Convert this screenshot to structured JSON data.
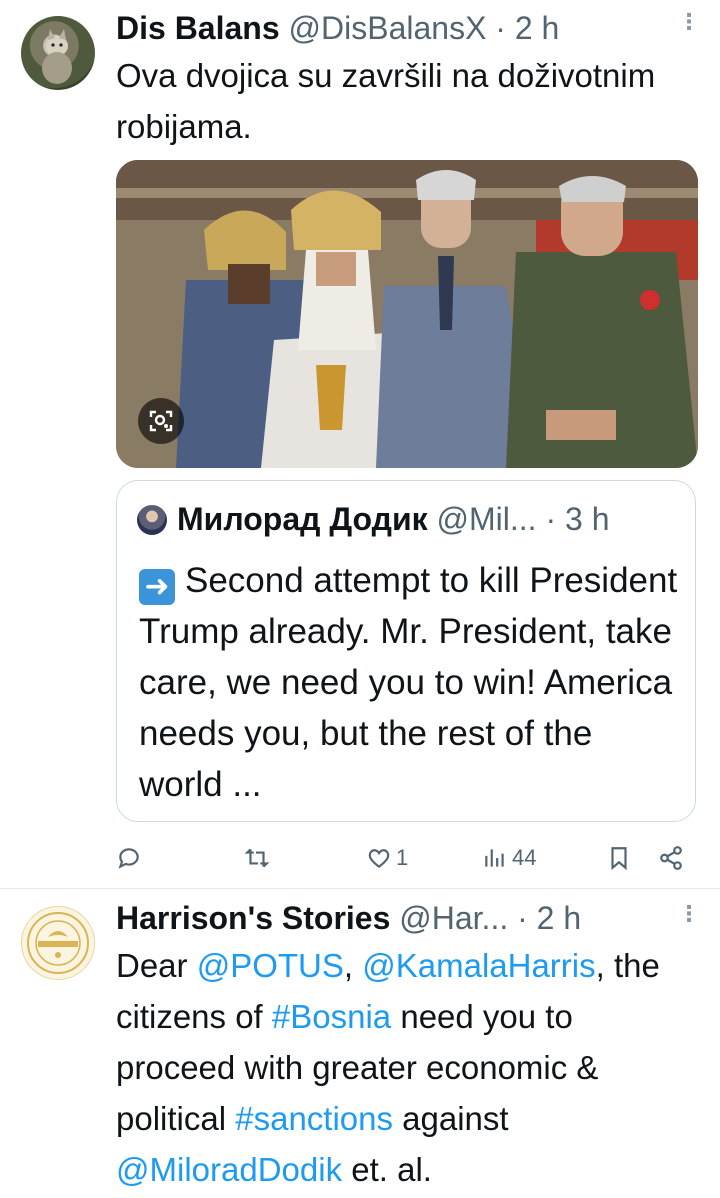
{
  "tweets": [
    {
      "name": "Dis Balans",
      "handle": "@DisBalansX",
      "sep": "·",
      "time": "2 h",
      "text": "Ova dvojica su završili na doživotnim robijama.",
      "quote": {
        "name": "Милорад Додик",
        "handle": "@Mil...",
        "sep": "·",
        "time": "3 h",
        "text": "Second attempt to kill President Trump already. Mr. President, take care, we need you to win!  America needs you, but the rest of the world ..."
      },
      "actions": {
        "reply_count": "",
        "retweet_count": "",
        "like_count": "1",
        "views_count": "44"
      }
    },
    {
      "name": "Harrison's Stories",
      "handle": "@Har...",
      "sep": "·",
      "time": "2 h",
      "text_parts": [
        "Dear ",
        "@POTUS",
        ", ",
        "@KamalaHarris",
        ", the citizens of ",
        "#Bosnia",
        " need you to proceed with greater economic & political ",
        "#sanctions",
        " against ",
        "@MiloradDodik",
        " et. al."
      ]
    }
  ],
  "icons": [
    "more-icon",
    "image-lens-icon",
    "arrow-right-icon",
    "reply-icon",
    "retweet-icon",
    "like-icon",
    "views-icon",
    "bookmark-icon",
    "share-icon"
  ],
  "colors": {
    "link": "#1d9bf0",
    "secondary": "#536471",
    "border": "#cfd9de"
  }
}
